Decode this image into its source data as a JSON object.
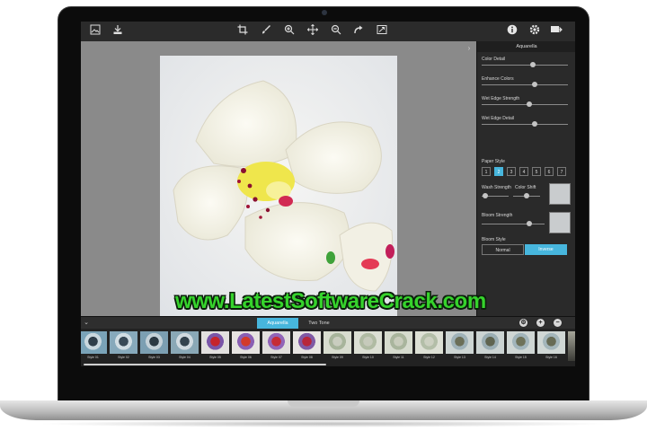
{
  "toolbar": {
    "left_icons": [
      "image-icon",
      "import-icon"
    ],
    "center_icons": [
      "crop-icon",
      "brush-icon",
      "zoom-in-icon",
      "move-icon",
      "zoom-out-icon",
      "redo-icon",
      "fit-icon"
    ],
    "right_icons": [
      "info-icon",
      "settings-icon",
      "share-icon"
    ]
  },
  "panel": {
    "title": "Aquarella",
    "color_detail": "Color Detail",
    "enhance_colors": "Enhance Colors",
    "wet_edge_strength": "Wet Edge Strength",
    "wet_edge_detail": "Wet Edge Detail",
    "paper_style": "Paper Style",
    "paper_style_options": [
      "1",
      "2",
      "3",
      "4",
      "5",
      "6",
      "7"
    ],
    "paper_style_selected": "2",
    "wash_strength": "Wash Strength",
    "color_shift": "Color Shift",
    "bloom_strength": "Bloom Strength",
    "bloom_style": "Bloom Style",
    "bloom_style_options": [
      "Normal",
      "Inverse"
    ],
    "bloom_style_selected": "Inverse",
    "slider_values": {
      "color_detail": 0.6,
      "enhance_colors": 0.62,
      "wet_edge_strength": 0.55,
      "wet_edge_detail": 0.62,
      "wash_strength": 0.03,
      "color_shift": 0.5,
      "bloom_strength": 0.78
    }
  },
  "tabs": {
    "items": [
      "Aquarella",
      "Two Tone"
    ],
    "active": "Aquarella"
  },
  "filmstrip": {
    "styles": [
      "Style 01",
      "Style 02",
      "Style 03",
      "Style 04",
      "Style 05",
      "Style 06",
      "Style 07",
      "Style 08",
      "Style 09",
      "Style 10",
      "Style 11",
      "Style 12",
      "Style 13",
      "Style 14",
      "Style 15",
      "Style 16"
    ]
  },
  "watermark": "www.LatestSoftwareCrack.com",
  "colors": {
    "accent": "#47b6dd",
    "watermark_green": "#36d32c"
  }
}
